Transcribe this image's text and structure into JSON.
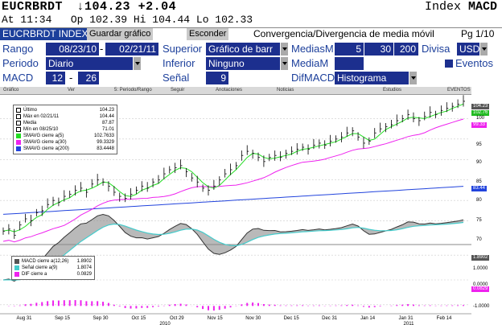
{
  "header": {
    "symbol": "EUCRBRDT",
    "price": "↓104.23",
    "change": "+2.04",
    "index_label": "Index",
    "index_value": "MACD",
    "time": "At 11:34",
    "open": "Op 102.39",
    "high": "Hi 104.44",
    "low": "Lo 102.33"
  },
  "fbar": {
    "ticker": "EUCRBRDT INDEX",
    "save": "Guardar gráfico",
    "hide": "Esconder",
    "title": "Convergencia/Divergencia de media móvil",
    "page": "Pg 1/10"
  },
  "params": {
    "rango_label": "Rango",
    "rango_from": "08/23/10",
    "rango_to": "02/21/11",
    "superior_label": "Superior",
    "superior_value": "Gráfico de barr",
    "mediasm_label": "MediasM",
    "mediasm_1": "5",
    "mediasm_2": "30",
    "mediasm_3": "200",
    "divisa_label": "Divisa",
    "divisa_value": "USD",
    "periodo_label": "Periodo",
    "periodo_value": "Diario",
    "inferior_label": "Inferior",
    "inferior_value": "Ninguno",
    "mediam_label": "MediaM",
    "eventos_label": "Eventos",
    "macd_label": "MACD",
    "macd_1": "12",
    "macd_2": "26",
    "senal_label": "Señal",
    "senal_value": "9",
    "difmacd_label": "DifMACD",
    "difmacd_value": "Histograma"
  },
  "toolbar": {
    "items": [
      "Gráfico",
      "Ver",
      "5: Periodo/Rango",
      "Seguir",
      "Anotaciones",
      "Noticias",
      "Estudios",
      "EVENTOS"
    ]
  },
  "legend_top": [
    {
      "name": "Último",
      "value": "104.23",
      "color": "#ffffff"
    },
    {
      "name": "Máx en 02/21/11",
      "value": "104.44",
      "color": "#ffffff"
    },
    {
      "name": "Media",
      "value": "87.87",
      "color": "#ffffff"
    },
    {
      "name": "Mín en 08/25/10",
      "value": "71.01",
      "color": "#ffffff"
    },
    {
      "name": "SMAVG cierre a(5)",
      "value": "102.7633",
      "color": "#22dd22"
    },
    {
      "name": "SMAVG cierre a(30)",
      "value": "99.3329",
      "color": "#ee22ee"
    },
    {
      "name": "SMAVG cierre a(200)",
      "value": "83.4448",
      "color": "#2244dd"
    }
  ],
  "legend_bottom": [
    {
      "name": "MACD cierre a(12,26)",
      "value": "1.8902",
      "color": "#555555"
    },
    {
      "name": "Señal cierre a(9)",
      "value": "1.8074",
      "color": "#44cccc"
    },
    {
      "name": "DIF cierre a",
      "value": "0.0829",
      "color": "#ee22ee"
    }
  ],
  "y_axis_top": [
    "100",
    "95",
    "90",
    "85",
    "80",
    "75",
    "70"
  ],
  "y_axis_bottom": [
    "1.0000",
    "0.0000",
    "-1.0000"
  ],
  "price_tags": {
    "last": "104.23",
    "ma5": "102.76",
    "ma30": "99.33",
    "ma200": "83.44"
  },
  "macd_tags": {
    "macd": "1.8902",
    "dif": "0.0829"
  },
  "x_axis": {
    "labels": [
      "Aug 31",
      "Sep 15",
      "Sep 30",
      "Oct 15",
      "Oct 29",
      "Nov 15",
      "Nov 30",
      "Dec 15",
      "Dec 31",
      "Jan 14",
      "Jan 31",
      "Feb 14"
    ],
    "years": [
      "2010",
      "2011"
    ]
  },
  "chart_data": {
    "type": "line",
    "ylim": [
      70,
      105
    ],
    "x_range": [
      "2010-08-23",
      "2011-02-21"
    ],
    "series": [
      {
        "name": "SMAVG cierre a(5)",
        "last": 102.7633
      },
      {
        "name": "SMAVG cierre a(30)",
        "last": 99.3329
      },
      {
        "name": "SMAVG cierre a(200)",
        "last": 83.4448
      }
    ],
    "price_close": [
      72.5,
      73,
      71.5,
      74,
      75.5,
      75,
      77,
      77.5,
      79,
      80,
      79.5,
      81,
      81.5,
      82.5,
      83,
      82,
      84,
      85,
      84.5,
      83.5,
      82,
      81,
      80.5,
      81.5,
      82.5,
      83.5,
      83,
      84.5,
      85,
      86.5,
      87.5,
      88,
      88.5,
      87,
      85.5,
      84.5,
      83,
      82.5,
      83.5,
      85,
      86.5,
      87.5,
      88.5,
      91,
      92,
      91.5,
      90.5,
      89.5,
      90.5,
      91,
      90.5,
      91.5,
      92,
      92.5,
      93,
      92.5,
      93.5,
      94,
      93.5,
      94.5,
      95,
      95.5,
      96.5,
      97,
      95.5,
      94,
      94.5,
      96.5,
      97.5,
      98,
      98.5,
      99.5,
      100,
      101,
      100,
      99.5,
      100.5,
      101.5,
      101,
      102,
      102.5,
      103,
      103.5,
      104.23
    ],
    "macd_range": [
      -1.3,
      1.3
    ]
  }
}
